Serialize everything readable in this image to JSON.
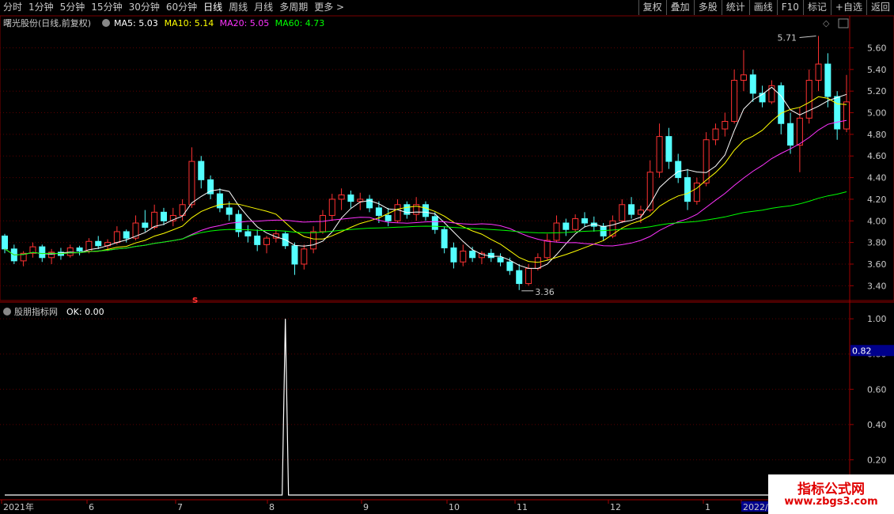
{
  "toolbar": {
    "periods": [
      "分时",
      "1分钟",
      "5分钟",
      "15分钟",
      "30分钟",
      "60分钟",
      "日线",
      "周线",
      "月线",
      "多周期",
      "更多 >"
    ],
    "active_period": "日线",
    "actions": [
      "复权",
      "叠加",
      "多股",
      "统计",
      "画线",
      "F10",
      "标记",
      "+自选",
      "返回"
    ]
  },
  "main_chart": {
    "title": "曙光股份(日线,前复权)",
    "ma": [
      {
        "label": "MA5: 5.03",
        "color": "#ffffff"
      },
      {
        "label": "MA10: 5.14",
        "color": "#ffff00"
      },
      {
        "label": "MA20: 5.05",
        "color": "#ff33ff"
      },
      {
        "label": "MA60: 4.73",
        "color": "#00ff00"
      }
    ],
    "y_ticks": [
      "5.60",
      "5.40",
      "5.20",
      "5.00",
      "4.80",
      "4.60",
      "4.40",
      "4.20",
      "4.00",
      "3.80",
      "3.60",
      "3.40"
    ],
    "high_label": "5.71",
    "low_label": "3.36",
    "signal_mark": "s"
  },
  "indicator": {
    "title": "股朋指标网",
    "value_label": "OK: 0.00",
    "y_ticks": [
      "1.00",
      "0.80",
      "0.60",
      "0.40",
      "0.20"
    ],
    "cursor_value": "0.82"
  },
  "x_axis": {
    "labels": [
      "2021年",
      "6",
      "7",
      "8",
      "9",
      "10",
      "11",
      "12",
      "1",
      "2022/"
    ]
  },
  "chart_data": {
    "type": "candlestick",
    "title": "曙光股份(日线,前复权)",
    "ylim": [
      3.3,
      5.75
    ],
    "ohlc": [
      [
        3.86,
        3.88,
        3.7,
        3.74
      ],
      [
        3.74,
        3.78,
        3.6,
        3.63
      ],
      [
        3.63,
        3.72,
        3.58,
        3.7
      ],
      [
        3.7,
        3.8,
        3.66,
        3.76
      ],
      [
        3.76,
        3.78,
        3.62,
        3.66
      ],
      [
        3.66,
        3.74,
        3.6,
        3.71
      ],
      [
        3.71,
        3.75,
        3.64,
        3.68
      ],
      [
        3.68,
        3.78,
        3.66,
        3.75
      ],
      [
        3.75,
        3.77,
        3.68,
        3.72
      ],
      [
        3.72,
        3.84,
        3.7,
        3.81
      ],
      [
        3.81,
        3.86,
        3.74,
        3.77
      ],
      [
        3.77,
        3.83,
        3.72,
        3.8
      ],
      [
        3.8,
        3.95,
        3.78,
        3.9
      ],
      [
        3.9,
        3.92,
        3.8,
        3.84
      ],
      [
        3.84,
        4.05,
        3.82,
        3.98
      ],
      [
        3.98,
        4.1,
        3.9,
        3.94
      ],
      [
        3.94,
        4.15,
        3.92,
        4.08
      ],
      [
        4.08,
        4.12,
        3.96,
        4.0
      ],
      [
        4.0,
        4.12,
        3.95,
        4.05
      ],
      [
        4.05,
        4.2,
        4.0,
        4.15
      ],
      [
        4.15,
        4.68,
        4.12,
        4.55
      ],
      [
        4.55,
        4.6,
        4.3,
        4.38
      ],
      [
        4.38,
        4.42,
        4.2,
        4.25
      ],
      [
        4.25,
        4.3,
        4.08,
        4.12
      ],
      [
        4.12,
        4.18,
        4.0,
        4.06
      ],
      [
        4.06,
        4.1,
        3.85,
        3.9
      ],
      [
        3.9,
        3.96,
        3.8,
        3.86
      ],
      [
        3.86,
        3.92,
        3.72,
        3.78
      ],
      [
        3.78,
        3.86,
        3.7,
        3.84
      ],
      [
        3.84,
        3.92,
        3.8,
        3.88
      ],
      [
        3.88,
        3.9,
        3.74,
        3.77
      ],
      [
        3.77,
        3.8,
        3.5,
        3.6
      ],
      [
        3.6,
        3.78,
        3.55,
        3.74
      ],
      [
        3.74,
        3.95,
        3.7,
        3.9
      ],
      [
        3.9,
        4.1,
        3.88,
        4.05
      ],
      [
        4.05,
        4.25,
        4.0,
        4.2
      ],
      [
        4.2,
        4.3,
        4.1,
        4.24
      ],
      [
        4.24,
        4.28,
        4.12,
        4.18
      ],
      [
        4.18,
        4.26,
        4.1,
        4.2
      ],
      [
        4.2,
        4.24,
        4.08,
        4.12
      ],
      [
        4.12,
        4.18,
        3.98,
        4.05
      ],
      [
        4.05,
        4.12,
        3.95,
        4.0
      ],
      [
        4.0,
        4.2,
        3.98,
        4.15
      ],
      [
        4.15,
        4.18,
        4.02,
        4.06
      ],
      [
        4.06,
        4.22,
        4.0,
        4.15
      ],
      [
        4.15,
        4.18,
        4.0,
        4.04
      ],
      [
        4.04,
        4.08,
        3.88,
        3.92
      ],
      [
        3.92,
        3.95,
        3.7,
        3.75
      ],
      [
        3.75,
        3.8,
        3.56,
        3.62
      ],
      [
        3.62,
        3.78,
        3.58,
        3.72
      ],
      [
        3.72,
        3.76,
        3.62,
        3.66
      ],
      [
        3.66,
        3.72,
        3.6,
        3.7
      ],
      [
        3.7,
        3.74,
        3.62,
        3.66
      ],
      [
        3.66,
        3.7,
        3.58,
        3.62
      ],
      [
        3.62,
        3.66,
        3.5,
        3.54
      ],
      [
        3.54,
        3.6,
        3.36,
        3.42
      ],
      [
        3.42,
        3.6,
        3.4,
        3.56
      ],
      [
        3.56,
        3.7,
        3.54,
        3.66
      ],
      [
        3.66,
        3.88,
        3.64,
        3.82
      ],
      [
        3.82,
        4.05,
        3.8,
        3.98
      ],
      [
        3.98,
        4.02,
        3.86,
        3.92
      ],
      [
        3.92,
        4.06,
        3.9,
        4.02
      ],
      [
        4.02,
        4.08,
        3.94,
        3.98
      ],
      [
        3.98,
        4.04,
        3.9,
        3.95
      ],
      [
        3.95,
        3.98,
        3.82,
        3.86
      ],
      [
        3.86,
        4.05,
        3.84,
        4.0
      ],
      [
        4.0,
        4.2,
        3.98,
        4.15
      ],
      [
        4.15,
        4.22,
        4.02,
        4.06
      ],
      [
        4.06,
        4.14,
        3.98,
        4.1
      ],
      [
        4.1,
        4.56,
        4.08,
        4.45
      ],
      [
        4.45,
        4.9,
        4.4,
        4.78
      ],
      [
        4.78,
        4.86,
        4.48,
        4.55
      ],
      [
        4.55,
        4.62,
        4.35,
        4.4
      ],
      [
        4.4,
        4.48,
        4.1,
        4.18
      ],
      [
        4.18,
        4.4,
        4.15,
        4.35
      ],
      [
        4.35,
        4.82,
        4.32,
        4.75
      ],
      [
        4.75,
        4.9,
        4.7,
        4.85
      ],
      [
        4.85,
        5.0,
        4.78,
        4.92
      ],
      [
        4.92,
        5.4,
        4.9,
        5.3
      ],
      [
        5.3,
        5.58,
        5.2,
        5.35
      ],
      [
        5.35,
        5.4,
        5.1,
        5.18
      ],
      [
        5.18,
        5.25,
        5.05,
        5.1
      ],
      [
        5.1,
        5.3,
        5.08,
        5.25
      ],
      [
        5.25,
        5.28,
        4.8,
        4.9
      ],
      [
        4.9,
        5.0,
        4.62,
        4.7
      ],
      [
        4.7,
        5.05,
        4.45,
        4.95
      ],
      [
        4.95,
        5.4,
        4.9,
        5.3
      ],
      [
        5.3,
        5.71,
        5.2,
        5.45
      ],
      [
        5.45,
        5.55,
        5.05,
        5.15
      ],
      [
        5.15,
        5.2,
        4.75,
        4.85
      ],
      [
        4.85,
        5.35,
        4.82,
        5.1
      ]
    ],
    "ma_series": [
      "MA5",
      "MA10",
      "MA20",
      "MA60"
    ],
    "indicator_series": {
      "name": "OK",
      "peak_index": 30,
      "peak_value": 1.0,
      "ylim": [
        0,
        1.05
      ]
    }
  }
}
